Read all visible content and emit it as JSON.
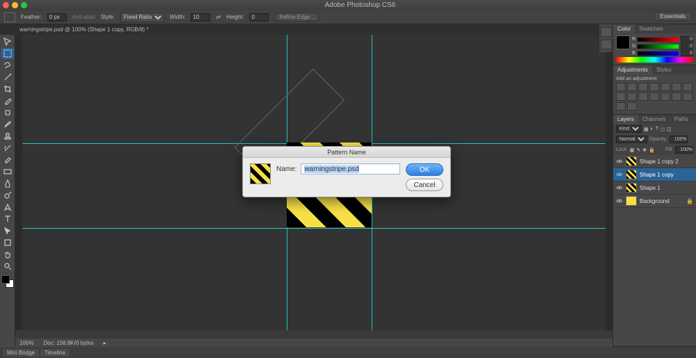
{
  "app_title": "Adobe Photoshop CS6",
  "workspace_label": "Essentials",
  "options": {
    "feather_label": "Feather:",
    "feather_value": "0 px",
    "antialias_label": "Anti-alias",
    "style_label": "Style:",
    "style_value": "Fixed Ratio",
    "width_label": "Width:",
    "width_value": "10",
    "height_label": "Height:",
    "height_value": "0",
    "refine_label": "Refine Edge..."
  },
  "document_tab": "warningstripe.psd @ 100% (Shape 1 copy, RGB/8) *",
  "status": {
    "zoom": "100%",
    "docinfo": "Doc: 158.8K/0 bytes"
  },
  "bottom_tabs": [
    "Mini Bridge",
    "Timeline"
  ],
  "panels": {
    "color_tabs": [
      "Color",
      "Swatches"
    ],
    "rgb": {
      "r_label": "R",
      "g_label": "G",
      "b_label": "B",
      "r": "0",
      "g": "0",
      "b": "0"
    },
    "adj_tabs": [
      "Adjustments",
      "Styles"
    ],
    "adj_hint": "Add an adjustment",
    "layer_tabs": [
      "Layers",
      "Channels",
      "Paths"
    ],
    "layer_kind": "Kind",
    "blend_mode": "Normal",
    "opacity_label": "Opacity:",
    "opacity": "100%",
    "lock_label": "Lock:",
    "fill_label": "Fill:",
    "fill": "100%"
  },
  "layers": [
    {
      "name": "Shape 1 copy 2",
      "thumb": "stripe",
      "selected": false,
      "locked": false
    },
    {
      "name": "Shape 1 copy",
      "thumb": "stripe",
      "selected": true,
      "locked": false
    },
    {
      "name": "Shape 1",
      "thumb": "stripe",
      "selected": false,
      "locked": false
    },
    {
      "name": "Background",
      "thumb": "bg",
      "selected": false,
      "locked": true
    }
  ],
  "guides": {
    "v": [
      380,
      502
    ],
    "h": [
      156,
      278
    ]
  },
  "dialog": {
    "title": "Pattern Name",
    "name_label": "Name:",
    "name_value": "warningstripe.psd",
    "ok": "OK",
    "cancel": "Cancel"
  }
}
